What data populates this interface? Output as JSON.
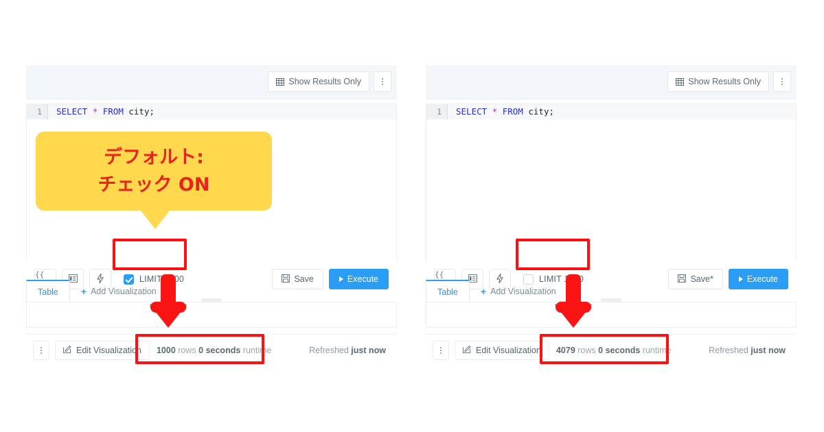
{
  "panels": [
    {
      "id": "left",
      "topbar": {
        "show_results_label": "Show Results Only",
        "grid_icon": "grid-icon",
        "kebab_icon": "kebab-menu-icon"
      },
      "editor": {
        "line_number": "1",
        "sql_keyword1": "SELECT",
        "sql_star": "*",
        "sql_keyword2": "FROM",
        "sql_rest": " city;"
      },
      "toolbar": {
        "braces_icon": "{{ }}",
        "format_icon": "format-indent-icon",
        "lightning_icon": "lightning-bolt-icon",
        "limit_label": "LIMIT 1000",
        "limit_checked": true,
        "save_label": "Save",
        "save_icon": "floppy-disk-icon",
        "execute_label": "Execute",
        "execute_icon": "play-icon"
      },
      "tabs": {
        "table_label": "Table",
        "add_visualization_label": "Add Visualization"
      },
      "footer": {
        "kebab_icon": "kebab-menu-icon",
        "edit_visualization_label": "Edit Visualization",
        "edit_icon": "pencil-square-icon",
        "rows_count": "1000",
        "rows_word": "rows",
        "runtime_value": "0 seconds",
        "runtime_word": "runtime",
        "refreshed_prefix": "Refreshed ",
        "refreshed_value": "just now"
      },
      "callout": {
        "line1": "デフォルト:",
        "line2": "チェック ON"
      }
    },
    {
      "id": "right",
      "topbar": {
        "show_results_label": "Show Results Only",
        "grid_icon": "grid-icon",
        "kebab_icon": "kebab-menu-icon"
      },
      "editor": {
        "line_number": "1",
        "sql_keyword1": "SELECT",
        "sql_star": "*",
        "sql_keyword2": "FROM",
        "sql_rest": " city;"
      },
      "toolbar": {
        "braces_icon": "{{ }}",
        "format_icon": "format-indent-icon",
        "lightning_icon": "lightning-bolt-icon",
        "limit_label": "LIMIT 1000",
        "limit_checked": false,
        "save_label": "Save*",
        "save_icon": "floppy-disk-icon",
        "execute_label": "Execute",
        "execute_icon": "play-icon"
      },
      "tabs": {
        "table_label": "Table",
        "add_visualization_label": "Add Visualization"
      },
      "footer": {
        "kebab_icon": "kebab-menu-icon",
        "edit_visualization_label": "Edit Visualization",
        "edit_icon": "pencil-square-icon",
        "rows_count": "4079",
        "rows_word": "rows",
        "runtime_value": "0 seconds",
        "runtime_word": "runtime",
        "refreshed_prefix": "Refreshed ",
        "refreshed_value": "just now"
      }
    }
  ],
  "colors": {
    "accent_blue": "#2a9df4",
    "annotation_red": "#ff0f0f",
    "callout_yellow": "#ffd84d",
    "callout_text_red": "#e8231e",
    "header_bg": "#f2f6f8",
    "sql_keyword": "#2a2ad6",
    "sql_operator": "#b030b0"
  }
}
